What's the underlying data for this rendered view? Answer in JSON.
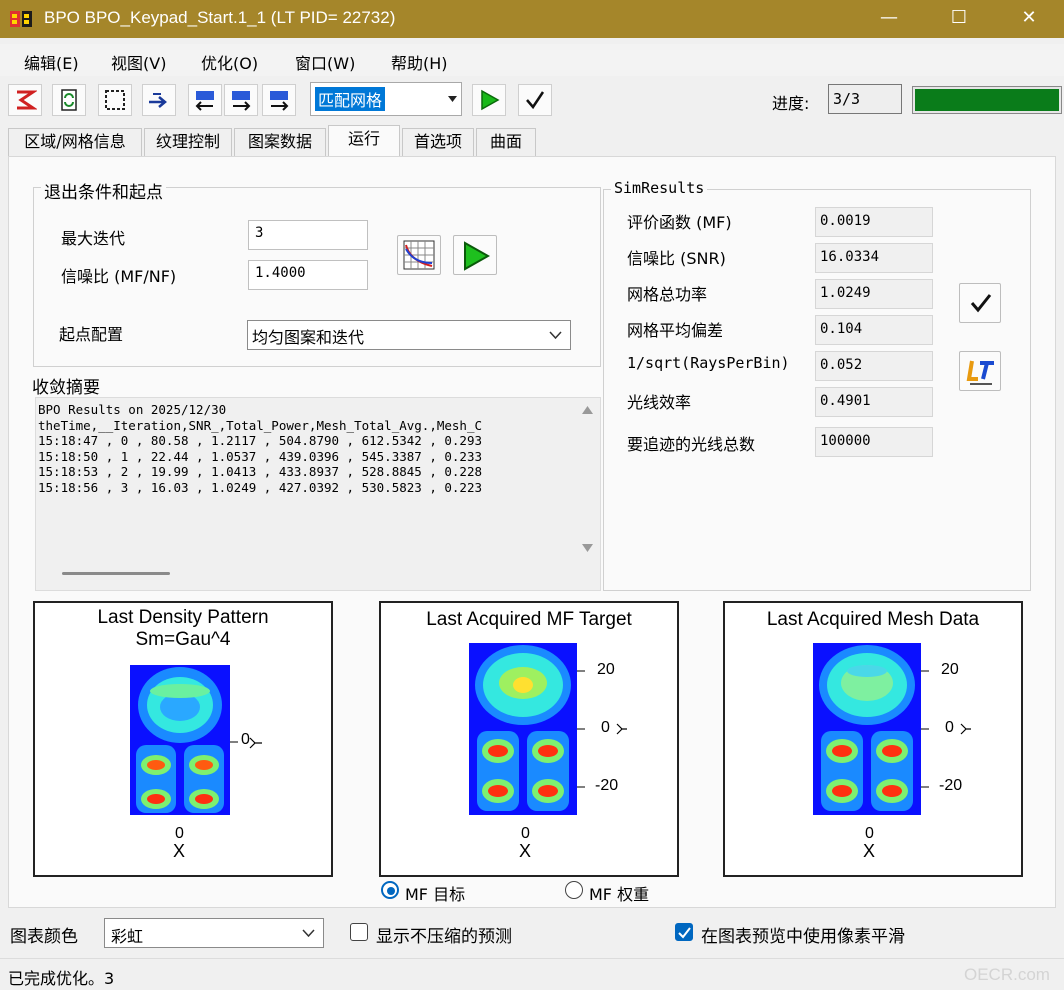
{
  "window": {
    "title": "BPO  BPO_Keypad_Start.1_1 (LT PID= 22732)",
    "minimize_glyph": "—",
    "maximize_glyph": "☐",
    "close_glyph": "✕"
  },
  "menu": [
    "编辑(E)",
    "视图(V)",
    "优化(O)",
    "窗口(W)",
    "帮助(H)"
  ],
  "toolbar": {
    "icons": [
      "stop-icon",
      "refresh-icon",
      "select-region-icon",
      "arrow-right-icon",
      "mesh-left-icon",
      "mesh-right-icon",
      "mesh-fill-icon",
      "run-icon",
      "check-icon"
    ],
    "mode_combo": "匹配网格",
    "progress_label": "进度:",
    "progress_value": "3/3",
    "progress_fraction": 1.0,
    "progress_color": "#0a7c1a"
  },
  "tabs": [
    "区域/网格信息",
    "纹理控制",
    "图案数据",
    "运行",
    "首选项",
    "曲面"
  ],
  "active_tab": "运行",
  "exit_group": {
    "title": "退出条件和起点",
    "max_iter_label": "最大迭代",
    "max_iter_value": "3",
    "snr_label": "信噪比 (MF/NF)",
    "snr_value": "1.4000",
    "start_label": "起点配置",
    "start_value": "均匀图案和迭代"
  },
  "sim_results": {
    "title": "SimResults",
    "rows": [
      {
        "label": "评价函数 (MF)",
        "value": "0.0019"
      },
      {
        "label": "信噪比 (SNR)",
        "value": "16.0334"
      },
      {
        "label": "网格总功率",
        "value": "1.0249"
      },
      {
        "label": "网格平均偏差",
        "value": "0.104"
      },
      {
        "label": "1/sqrt(RaysPerBin)",
        "value": "0.052"
      },
      {
        "label": "光线效率",
        "value": "0.4901"
      },
      {
        "label": "要追迹的光线总数",
        "value": "100000"
      }
    ]
  },
  "convergence": {
    "title": "收敛摘要",
    "text": "BPO Results on 2025/12/30\ntheTime,__Iteration,SNR_,Total_Power,Mesh_Total_Avg.,Mesh_C\n15:18:47 , 0 , 80.58 , 1.2117 , 504.8790 , 612.5342 , 0.293\n15:18:50 , 1 , 22.44 , 1.0537 , 439.0396 , 545.3387 , 0.233\n15:18:53 , 2 , 19.99 , 1.0413 , 433.8937 , 528.8845 , 0.228\n15:18:56 , 3 , 16.03 , 1.0249 , 427.0392 , 530.5823 , 0.223"
  },
  "plots": [
    {
      "title": "Last Density Pattern",
      "subtitle": "Sm=Gau^4",
      "y_ticks": [
        "0"
      ],
      "x_tick": "0",
      "xlabel": "X",
      "ylabel": "Y"
    },
    {
      "title": "Last Acquired MF Target",
      "subtitle": "",
      "y_ticks": [
        "20",
        "0",
        "-20"
      ],
      "x_tick": "0",
      "xlabel": "X",
      "ylabel": "Y"
    },
    {
      "title": "Last Acquired Mesh Data",
      "subtitle": "",
      "y_ticks": [
        "20",
        "0",
        "-20"
      ],
      "x_tick": "0",
      "xlabel": "X",
      "ylabel": "Y"
    }
  ],
  "radio": {
    "mf_target": "MF 目标",
    "mf_weight": "MF 权重",
    "selected": "mf_target"
  },
  "bottom": {
    "chart_color_label": "图表颜色",
    "chart_color_value": "彩虹",
    "uncompressed_label": "显示不压缩的预测",
    "uncompressed_checked": false,
    "smooth_label": "在图表预览中使用像素平滑",
    "smooth_checked": true
  },
  "status": {
    "text": "已完成优化。3",
    "watermark": "OECR.com"
  }
}
